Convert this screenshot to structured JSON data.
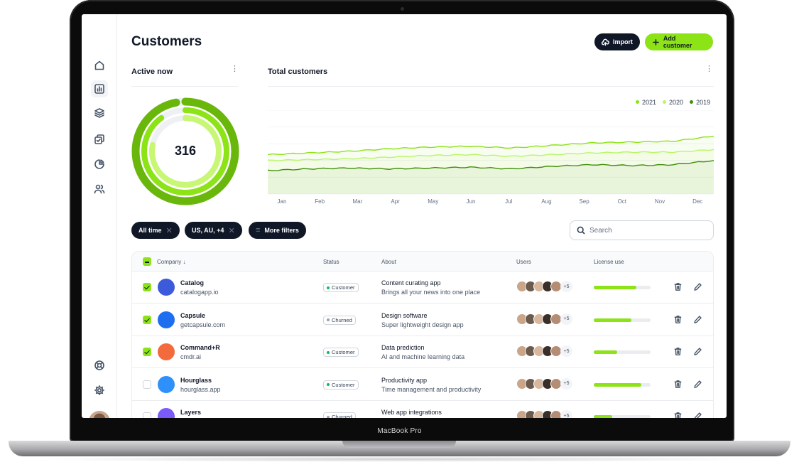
{
  "device_label": "MacBook Pro",
  "header": {
    "title": "Customers",
    "import_label": "Import",
    "add_label": "Add customer"
  },
  "active_now": {
    "title": "Active now",
    "value": "316",
    "rings": [
      0.97,
      0.9,
      0.78
    ]
  },
  "total_customers": {
    "title": "Total customers",
    "legend": [
      {
        "label": "2021",
        "color": "#8ce316"
      },
      {
        "label": "2020",
        "color": "#b9f56a"
      },
      {
        "label": "2019",
        "color": "#3f8f0a"
      }
    ]
  },
  "chart_data": {
    "type": "line",
    "title": "Total customers",
    "categories": [
      "Jan",
      "Feb",
      "Mar",
      "Apr",
      "May",
      "Jun",
      "Jul",
      "Aug",
      "Sep",
      "Oct",
      "Nov",
      "Dec"
    ],
    "series": [
      {
        "name": "2021",
        "color": "#8ce316",
        "values": [
          47,
          49,
          51,
          54,
          56,
          57,
          55,
          58,
          61,
          62,
          63,
          69
        ]
      },
      {
        "name": "2020",
        "color": "#b9f56a",
        "values": [
          40,
          41,
          42,
          44,
          46,
          47,
          45,
          47,
          49,
          50,
          50,
          53
        ]
      },
      {
        "name": "2019",
        "color": "#3f8f0a",
        "values": [
          28,
          30,
          31,
          30,
          31,
          32,
          30,
          33,
          35,
          34,
          35,
          40
        ]
      }
    ],
    "ylim": [
      0,
      100
    ],
    "grid": true
  },
  "filters": {
    "chips": [
      "All time",
      "US, AU, +4"
    ],
    "more_label": "More filters",
    "search_placeholder": "Search"
  },
  "table": {
    "headers": {
      "company": "Company",
      "status": "Status",
      "about": "About",
      "users": "Users",
      "license": "License use"
    },
    "rows": [
      {
        "name": "Catalog",
        "site": "catalogapp.io",
        "status": "Customer",
        "about_title": "Content curating app",
        "about_desc": "Brings all your news into one place",
        "users_more": "+5",
        "license": 0.75,
        "checked": true,
        "logo_color": "#3b5bdb"
      },
      {
        "name": "Capsule",
        "site": "getcapsule.com",
        "status": "Churned",
        "about_title": "Design software",
        "about_desc": "Super lightweight design app",
        "users_more": "+5",
        "license": 0.66,
        "checked": true,
        "logo_color": "#1e6ff0"
      },
      {
        "name": "Command+R",
        "site": "cmdr.ai",
        "status": "Customer",
        "about_title": "Data prediction",
        "about_desc": "AI and machine learning data",
        "users_more": "+5",
        "license": 0.41,
        "checked": true,
        "logo_color": "#f36b3c"
      },
      {
        "name": "Hourglass",
        "site": "hourglass.app",
        "status": "Customer",
        "about_title": "Productivity app",
        "about_desc": "Time management and productivity",
        "users_more": "+5",
        "license": 0.84,
        "checked": false,
        "logo_color": "#2e90fa"
      },
      {
        "name": "Layers",
        "site": "",
        "status": "Churned",
        "about_title": "Web app integrations",
        "about_desc": "",
        "users_more": "+5",
        "license": 0.32,
        "checked": false,
        "logo_color": "#7a5af8"
      }
    ]
  }
}
